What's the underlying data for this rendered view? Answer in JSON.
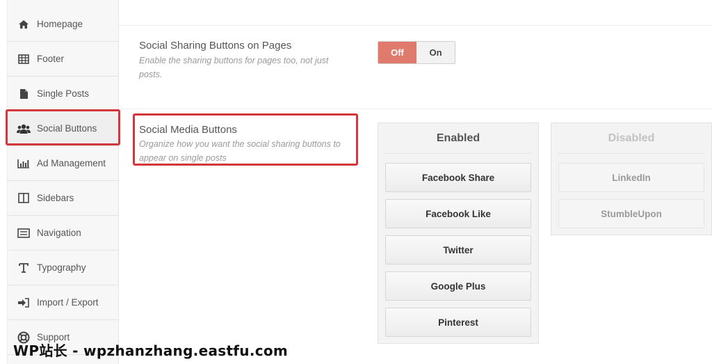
{
  "sidebar": {
    "items": [
      {
        "label": "Homepage",
        "icon": "home-icon"
      },
      {
        "label": "Footer",
        "icon": "table-icon"
      },
      {
        "label": "Single Posts",
        "icon": "file-icon"
      },
      {
        "label": "Social Buttons",
        "icon": "users-icon"
      },
      {
        "label": "Ad Management",
        "icon": "bar-chart-icon"
      },
      {
        "label": "Sidebars",
        "icon": "columns-icon"
      },
      {
        "label": "Navigation",
        "icon": "list-icon"
      },
      {
        "label": "Typography",
        "icon": "text-icon"
      },
      {
        "label": "Import / Export",
        "icon": "sign-in-icon"
      },
      {
        "label": "Support",
        "icon": "lifebuoy-icon"
      }
    ],
    "active": "Social Buttons"
  },
  "sharing_pages": {
    "title": "Social Sharing Buttons on Pages",
    "description": "Enable the sharing buttons for pages too, not just posts.",
    "toggle_off": "Off",
    "toggle_on": "On",
    "state": "Off"
  },
  "media_buttons": {
    "title": "Social Media Buttons",
    "description": "Organize how you want the social sharing buttons to appear on single posts"
  },
  "enabled": {
    "heading": "Enabled",
    "buttons": [
      "Facebook Share",
      "Facebook Like",
      "Twitter",
      "Google Plus",
      "Pinterest"
    ]
  },
  "disabled": {
    "heading": "Disabled",
    "buttons": [
      "LinkedIn",
      "StumbleUpon"
    ]
  },
  "watermark": "WP站长 - wpzhanzhang.eastfu.com",
  "colors": {
    "highlight": "#d3363c",
    "toggle_off": "#e07a6d"
  }
}
